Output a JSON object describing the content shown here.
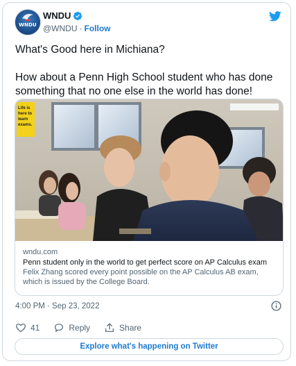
{
  "author": {
    "name": "WNDU",
    "handle": "@WNDU",
    "separator": "·",
    "follow_label": "Follow",
    "avatar_text": "WNDU"
  },
  "tweet": {
    "text": "What's Good here in Michiana?\n\nHow about a Penn High School student who has done something that no one else in the world has done!"
  },
  "link_card": {
    "domain": "wndu.com",
    "title": "Penn student only in the world to get perfect score on AP Calculus exam",
    "description": "Felix Zhang scored every point possible on the AP Calculus AB exam, which is issued by the College Board.",
    "poster_text": "Life is\nhere to\nlearn\nexams."
  },
  "meta": {
    "timestamp": "4:00 PM · Sep 23, 2022"
  },
  "actions": {
    "like_count": "41",
    "reply_label": "Reply",
    "share_label": "Share"
  },
  "footer": {
    "explore_label": "Explore what's happening on Twitter"
  },
  "colors": {
    "accent": "#1d9bf0",
    "link": "#1d7ad0",
    "muted": "#536471",
    "border": "#cfd9de"
  },
  "icons": [
    "verified-badge-icon",
    "twitter-bird-icon",
    "info-icon",
    "heart-icon",
    "reply-bubble-icon",
    "share-icon"
  ]
}
